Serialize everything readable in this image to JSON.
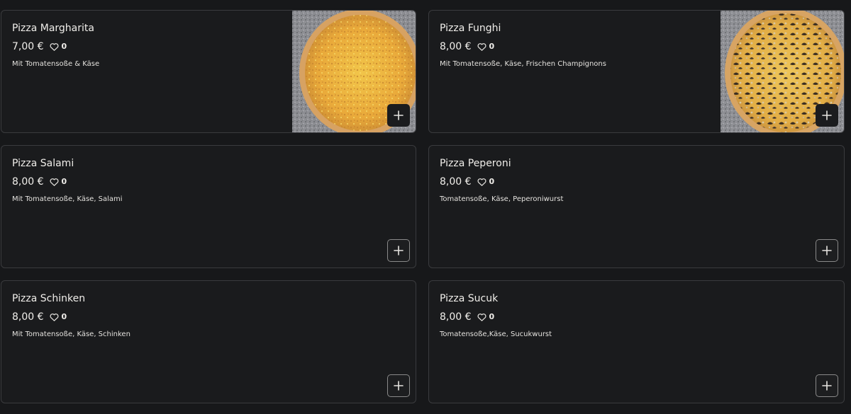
{
  "menu": {
    "currency_note": "",
    "items": [
      {
        "name": "Pizza Margharita",
        "price": "7,00 €",
        "likes": "0",
        "description": "Mit Tomatensoße & Käse",
        "has_image": true,
        "add_icon": "plus-icon",
        "like_icon": "heart-icon"
      },
      {
        "name": "Pizza Funghi",
        "price": "8,00 €",
        "likes": "0",
        "description": "Mit Tomatensoße, Käse, Frischen Champignons",
        "has_image": true,
        "add_icon": "plus-icon",
        "like_icon": "heart-icon"
      },
      {
        "name": "Pizza Salami",
        "price": "8,00 €",
        "likes": "0",
        "description": "Mit Tomatensoße, Käse, Salami",
        "has_image": false,
        "add_icon": "plus-icon",
        "like_icon": "heart-icon"
      },
      {
        "name": "Pizza Peperoni",
        "price": "8,00 €",
        "likes": "0",
        "description": "Tomatensoße, Käse, Peperoniwurst",
        "has_image": false,
        "add_icon": "plus-icon",
        "like_icon": "heart-icon"
      },
      {
        "name": "Pizza Schinken",
        "price": "8,00 €",
        "likes": "0",
        "description": "Mit Tomatensoße, Käse, Schinken",
        "has_image": false,
        "add_icon": "plus-icon",
        "like_icon": "heart-icon"
      },
      {
        "name": "Pizza Sucuk",
        "price": "8,00 €",
        "likes": "0",
        "description": "Tomatensoße,Käse, Sucukwurst",
        "has_image": false,
        "add_icon": "plus-icon",
        "like_icon": "heart-icon"
      }
    ]
  },
  "colors": {
    "background": "#17181a",
    "card_border": "#3a3b3e",
    "text": "#f0eeea"
  }
}
